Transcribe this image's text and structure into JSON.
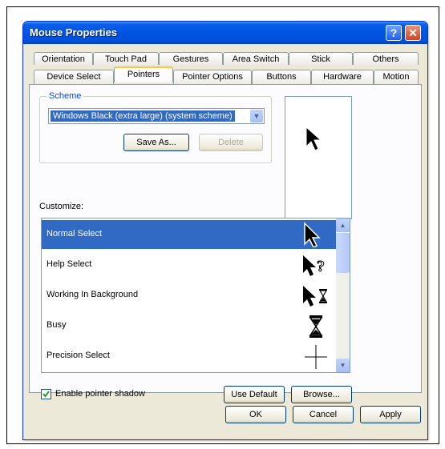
{
  "window": {
    "title": "Mouse Properties"
  },
  "tabs": {
    "row_back": [
      "Orientation",
      "Touch Pad",
      "Gestures",
      "Area Switch",
      "Stick",
      "Others"
    ],
    "row_front": [
      "Device Select",
      "Pointers",
      "Pointer Options",
      "Buttons",
      "Hardware",
      "Motion"
    ],
    "active": "Pointers"
  },
  "scheme": {
    "group_label": "Scheme",
    "selected": "Windows Black (extra large) (system scheme)",
    "save_as_label": "Save As...",
    "delete_label": "Delete"
  },
  "customize": {
    "label": "Customize:",
    "items": [
      {
        "label": "Normal Select",
        "icon": "arrow-cursor-icon",
        "selected": true
      },
      {
        "label": "Help Select",
        "icon": "help-cursor-icon",
        "selected": false
      },
      {
        "label": "Working In Background",
        "icon": "working-cursor-icon",
        "selected": false
      },
      {
        "label": "Busy",
        "icon": "hourglass-icon",
        "selected": false
      },
      {
        "label": "Precision Select",
        "icon": "crosshair-icon",
        "selected": false
      }
    ]
  },
  "shadow": {
    "label": "Enable pointer shadow",
    "checked": true
  },
  "buttons": {
    "use_default": "Use Default",
    "browse": "Browse...",
    "ok": "OK",
    "cancel": "Cancel",
    "apply": "Apply"
  }
}
